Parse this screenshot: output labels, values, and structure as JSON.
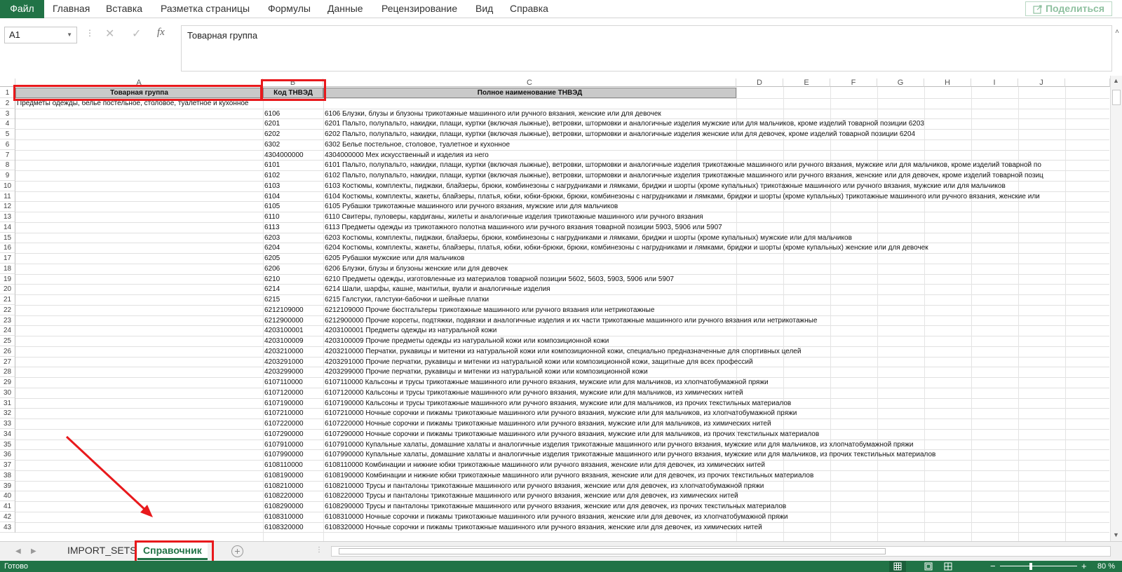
{
  "ribbon": {
    "tabs": [
      "Файл",
      "Главная",
      "Вставка",
      "Разметка страницы",
      "Формулы",
      "Данные",
      "Рецензирование",
      "Вид",
      "Справка"
    ],
    "share_label": "Поделиться"
  },
  "formula_bar": {
    "name_box": "A1",
    "formula": "Товарная группа",
    "cancel_icon": "✕",
    "confirm_icon": "✓",
    "fx_label": "fx"
  },
  "columns": [
    "A",
    "B",
    "C",
    "D",
    "E",
    "F",
    "G",
    "H",
    "I",
    "J"
  ],
  "headers": {
    "a": "Товарная группа",
    "b": "Код ТНВЭД",
    "c": "Полное наименование ТНВЭД"
  },
  "row2_a": "Предметы одежды, белье постельное, столовое, туалетное и кухонное",
  "rows": [
    [
      "6106",
      "6106 Блузки, блузы и блузоны трикотажные машинного или ручного вязания, женские или для девочек"
    ],
    [
      "6201",
      "6201 Пальто, полупальто, накидки, плащи, куртки (включая лыжные), ветровки, штормовки и аналогичные изделия мужские или для мальчиков, кроме изделий товарной позиции 6203"
    ],
    [
      "6202",
      "6202 Пальто, полупальто, накидки, плащи, куртки (включая лыжные), ветровки, штормовки и аналогичные изделия женские или для девочек, кроме изделий товарной позиции 6204"
    ],
    [
      "6302",
      "6302 Белье постельное, столовое, туалетное и кухонное"
    ],
    [
      "4304000000",
      "4304000000 Мех искусственный и изделия из него"
    ],
    [
      "6101",
      "6101 Пальто, полупальто, накидки, плащи, куртки (включая лыжные), ветровки, штормовки и аналогичные изделия трикотажные машинного или ручного вязания, мужские или для мальчиков, кроме изделий товарной по"
    ],
    [
      "6102",
      "6102 Пальто, полупальто, накидки, плащи, куртки (включая лыжные), ветровки, штормовки и аналогичные изделия трикотажные машинного или ручного вязания, женские или для девочек, кроме изделий товарной позиц"
    ],
    [
      "6103",
      "6103 Костюмы, комплекты, пиджаки, блайзеры, брюки, комбинезоны с нагрудниками и лямками, бриджи и шорты (кроме купальных) трикотажные машинного или ручного вязания, мужские или для мальчиков"
    ],
    [
      "6104",
      "6104 Костюмы, комплекты, жакеты, блайзеры, платья, юбки, юбки-брюки, брюки, комбинезоны с нагрудниками и лямками, бриджи и шорты (кроме купальных) трикотажные машинного или ручного вязания, женские или"
    ],
    [
      "6105",
      "6105 Рубашки трикотажные машинного или ручного вязания, мужские или для мальчиков"
    ],
    [
      "6110",
      "6110 Свитеры, пуловеры, кардиганы, жилеты и аналогичные изделия трикотажные машинного или ручного вязания"
    ],
    [
      "6113",
      "6113 Предметы одежды из трикотажного полотна машинного или ручного вязания товарной позиции 5903, 5906 или 5907"
    ],
    [
      "6203",
      "6203 Костюмы, комплекты, пиджаки, блайзеры, брюки, комбинезоны с нагрудниками и лямками, бриджи и шорты (кроме купальных) мужские или для мальчиков"
    ],
    [
      "6204",
      "6204 Костюмы, комплекты, жакеты, блайзеры, платья, юбки, юбки-брюки, брюки, комбинезоны с нагрудниками и лямками, бриджи и шорты (кроме купальных) женские или для девочек"
    ],
    [
      "6205",
      "6205 Рубашки мужские или для мальчиков"
    ],
    [
      "6206",
      "6206 Блузки, блузы и блузоны женские или для девочек"
    ],
    [
      "6210",
      "6210 Предметы одежды, изготовленные из материалов товарной позиции 5602, 5603, 5903, 5906 или 5907"
    ],
    [
      "6214",
      "6214 Шали, шарфы, кашне, мантильи, вуали и аналогичные изделия"
    ],
    [
      "6215",
      "6215 Галстуки, галстуки-бабочки и шейные платки"
    ],
    [
      "6212109000",
      "6212109000 Прочие бюстгальтеры трикотажные машинного или ручного вязания или нетрикотажные"
    ],
    [
      "6212900000",
      "6212900000 Прочие корсеты, подтяжки, подвязки и аналогичные изделия и их части трикотажные машинного или ручного вязания или нетрикотажные"
    ],
    [
      "4203100001",
      "4203100001 Предметы одежды из натуральной кожи"
    ],
    [
      "4203100009",
      "4203100009 Прочие предметы одежды из натуральной кожи или композиционной кожи"
    ],
    [
      "4203210000",
      "4203210000 Перчатки, рукавицы и митенки из натуральной кожи или композиционной кожи, специально предназначенные для спортивных целей"
    ],
    [
      "4203291000",
      "4203291000 Прочие перчатки, рукавицы и митенки из натуральной кожи или композиционной кожи, защитные для всех профессий"
    ],
    [
      "4203299000",
      "4203299000 Прочие перчатки, рукавицы и митенки из натуральной кожи или композиционной кожи"
    ],
    [
      "6107110000",
      "6107110000 Кальсоны и трусы трикотажные машинного или ручного вязания, мужские или для мальчиков, из хлопчатобумажной пряжи"
    ],
    [
      "6107120000",
      "6107120000 Кальсоны и трусы трикотажные машинного или ручного вязания, мужские или для мальчиков, из химических нитей"
    ],
    [
      "6107190000",
      "6107190000 Кальсоны и трусы трикотажные машинного или ручного вязания, мужские или для мальчиков, из прочих текстильных материалов"
    ],
    [
      "6107210000",
      "6107210000 Ночные сорочки и пижамы трикотажные машинного или ручного вязания, мужские или для мальчиков, из хлопчатобумажной пряжи"
    ],
    [
      "6107220000",
      "6107220000 Ночные сорочки и пижамы трикотажные машинного или ручного вязания, мужские или для мальчиков, из химических нитей"
    ],
    [
      "6107290000",
      "6107290000 Ночные сорочки и пижамы трикотажные машинного или ручного вязания, мужские или для мальчиков, из прочих текстильных материалов"
    ],
    [
      "6107910000",
      "6107910000 Купальные халаты, домашние халаты и аналогичные изделия трикотажные машинного или ручного вязания, мужские или для мальчиков, из хлопчатобумажной пряжи"
    ],
    [
      "6107990000",
      "6107990000 Купальные халаты, домашние халаты и аналогичные изделия трикотажные машинного или ручного вязания, мужские или для мальчиков, из прочих текстильных материалов"
    ],
    [
      "6108110000",
      "6108110000 Комбинации и нижние юбки трикотажные машинного или ручного вязания, женские или для девочек, из химических нитей"
    ],
    [
      "6108190000",
      "6108190000 Комбинации и нижние юбки трикотажные машинного или ручного вязания, женские или для девочек, из прочих текстильных материалов"
    ],
    [
      "6108210000",
      "6108210000 Трусы и панталоны трикотажные машинного или ручного вязания, женские или для девочек, из хлопчатобумажной пряжи"
    ],
    [
      "6108220000",
      "6108220000 Трусы и панталоны трикотажные машинного или ручного вязания, женские или для девочек, из химических нитей"
    ],
    [
      "6108290000",
      "6108290000 Трусы и панталоны трикотажные машинного или ручного вязания, женские или для девочек, из прочих текстильных материалов"
    ],
    [
      "6108310000",
      "6108310000 Ночные сорочки и пижамы трикотажные машинного или ручного вязания, женские или для девочек, из хлопчатобумажной пряжи"
    ],
    [
      "6108320000",
      "6108320000 Ночные сорочки и пижамы трикотажные машинного или ручного вязания, женские или для девочек, из химических нитей"
    ]
  ],
  "sheet_tabs": [
    "IMPORT_SETS",
    "Справочник"
  ],
  "active_sheet": "Справочник",
  "status": {
    "ready": "Готово",
    "zoom": "80 %",
    "zoom_minus": "−",
    "zoom_plus": "+"
  },
  "colors": {
    "excel_green": "#217346",
    "annotation_red": "#e8191c"
  }
}
